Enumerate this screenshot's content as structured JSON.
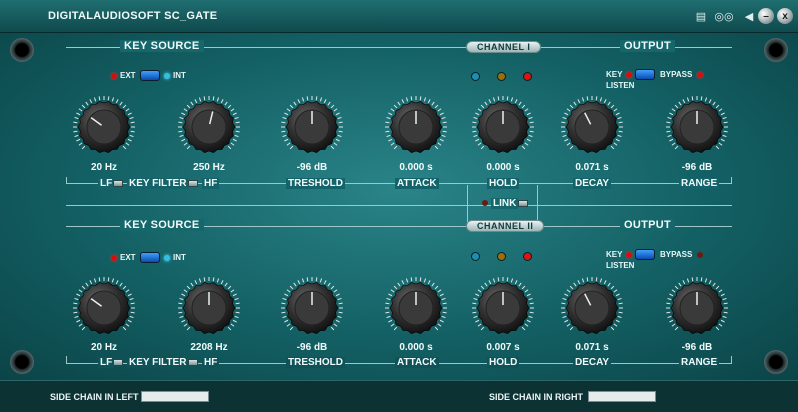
{
  "app": {
    "title": "DIGITALAUDIOSOFT SC_GATE"
  },
  "titlebar": {
    "close_label": "x"
  },
  "channels": [
    {
      "badge": "CHANNEL I",
      "key_source": "KEY SOURCE",
      "output": "OUTPUT",
      "ext": "EXT",
      "int": "INT",
      "key_listen_1": "KEY",
      "key_listen_2": "LISTEN",
      "bypass": "BYPASS",
      "lf": "LF",
      "key_filter": "KEY FILTER",
      "hf": "HF",
      "knobs": [
        {
          "value": "20 Hz",
          "level": 0.3
        },
        {
          "value": "250 Hz",
          "level": 0.55
        },
        {
          "value": "-96 dB",
          "level": 0.5
        },
        {
          "value": "0.000 s",
          "level": 0.5
        },
        {
          "value": "0.000 s",
          "level": 0.5
        },
        {
          "value": "0.071 s",
          "level": 0.4
        },
        {
          "value": "-96 dB",
          "level": 0.5
        }
      ],
      "params": {
        "treshold": "TRESHOLD",
        "attack": "ATTACK",
        "hold": "HOLD",
        "decay": "DECAY",
        "range": "RANGE"
      }
    },
    {
      "badge": "CHANNEL II",
      "key_source": "KEY SOURCE",
      "output": "OUTPUT",
      "ext": "EXT",
      "int": "INT",
      "key_listen_1": "KEY",
      "key_listen_2": "LISTEN",
      "bypass": "BYPASS",
      "lf": "LF",
      "key_filter": "KEY FILTER",
      "hf": "HF",
      "knobs": [
        {
          "value": "20 Hz",
          "level": 0.3
        },
        {
          "value": "2208 Hz",
          "level": 0.5
        },
        {
          "value": "-96 dB",
          "level": 0.5
        },
        {
          "value": "0.000 s",
          "level": 0.5
        },
        {
          "value": "0.007 s",
          "level": 0.5
        },
        {
          "value": "0.071 s",
          "level": 0.4
        },
        {
          "value": "-96 dB",
          "level": 0.5
        }
      ],
      "params": {
        "treshold": "TRESHOLD",
        "attack": "ATTACK",
        "hold": "HOLD",
        "decay": "DECAY",
        "range": "RANGE"
      }
    }
  ],
  "link": {
    "label": "LINK"
  },
  "bottom": {
    "left": "SIDE CHAIN IN LEFT",
    "right": "SIDE CHAIN IN RIGHT"
  },
  "colors": {
    "panel": "#136064",
    "accent_blue": "#2fc0e8",
    "led_red": "#d11010",
    "led_amber": "#a06e08",
    "led_blue": "#1d8fb5"
  }
}
